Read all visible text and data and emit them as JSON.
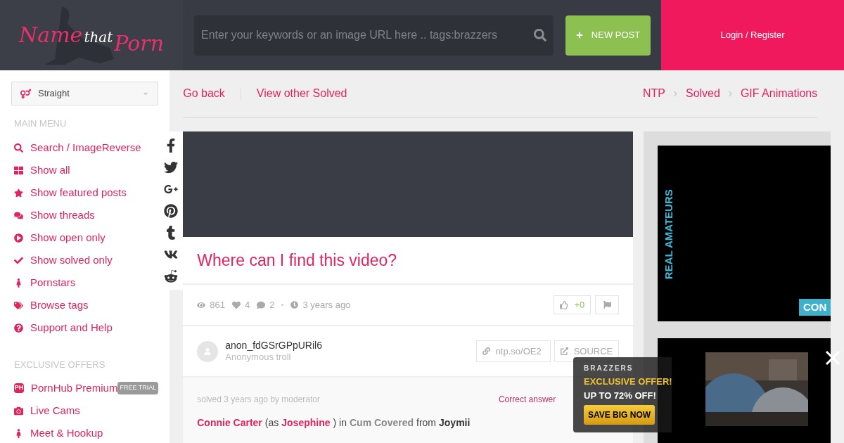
{
  "header": {
    "logo": {
      "name": "Name",
      "that": "that",
      "porn": "Porn"
    },
    "search": {
      "placeholder": "Enter your keywords or an image URL here .. tags:brazzers"
    },
    "new_post": "NEW POST",
    "login": "Login / Register"
  },
  "sidebar": {
    "orientation": "Straight",
    "main_menu_title": "MAIN MENU",
    "main_menu": [
      {
        "label": "Search / ImageReverse"
      },
      {
        "label": "Show all"
      },
      {
        "label": "Show featured posts"
      },
      {
        "label": "Show threads"
      },
      {
        "label": "Show open only"
      },
      {
        "label": "Show solved only"
      },
      {
        "label": "Pornstars"
      },
      {
        "label": "Browse tags"
      },
      {
        "label": "Support and Help"
      }
    ],
    "offers_title": "EXCLUSIVE OFFERS",
    "offers": [
      {
        "label": "PornHub Premium",
        "logo": "PH",
        "badge": "FREE TRIAL"
      },
      {
        "label": "Live Cams"
      },
      {
        "label": "Meet & Hookup"
      }
    ]
  },
  "nav": {
    "links": [
      "Go back",
      "View other Solved"
    ],
    "breadcrumb": [
      "NTP",
      "Solved",
      "GIF Animations"
    ]
  },
  "post": {
    "title": "Where can I find this video?",
    "stats": {
      "views": "861",
      "likes": "4",
      "comments": "2",
      "time": "3 years ago"
    },
    "vote": "+0",
    "author": {
      "name": "anon_fdGSrGPpURil6",
      "rank": "Anonymous troll"
    },
    "short_link": "ntp.so/OE2",
    "source": "SOURCE",
    "solved": {
      "meta": "solved 3 years ago by moderator",
      "label": "Correct answer",
      "answer": [
        {
          "kind": "star",
          "text": "Connie Carter"
        },
        {
          "kind": "text",
          "text": "(as"
        },
        {
          "kind": "star",
          "text": "Josephine"
        },
        {
          "kind": "text",
          "text": ") in"
        },
        {
          "kind": "scene",
          "text": "Cum Covered"
        },
        {
          "kind": "text",
          "text": "from"
        },
        {
          "kind": "site",
          "text": "Joymii"
        }
      ]
    }
  },
  "ads": {
    "side_banner": {
      "vertical_text": "REAL AMATEURS",
      "badge": "CON"
    },
    "popup": {
      "brand": "BRAZZERS",
      "headline": "EXCLUSIVE OFFER!",
      "subline": "UP TO 72% OFF!",
      "button": "SAVE BIG NOW"
    }
  }
}
